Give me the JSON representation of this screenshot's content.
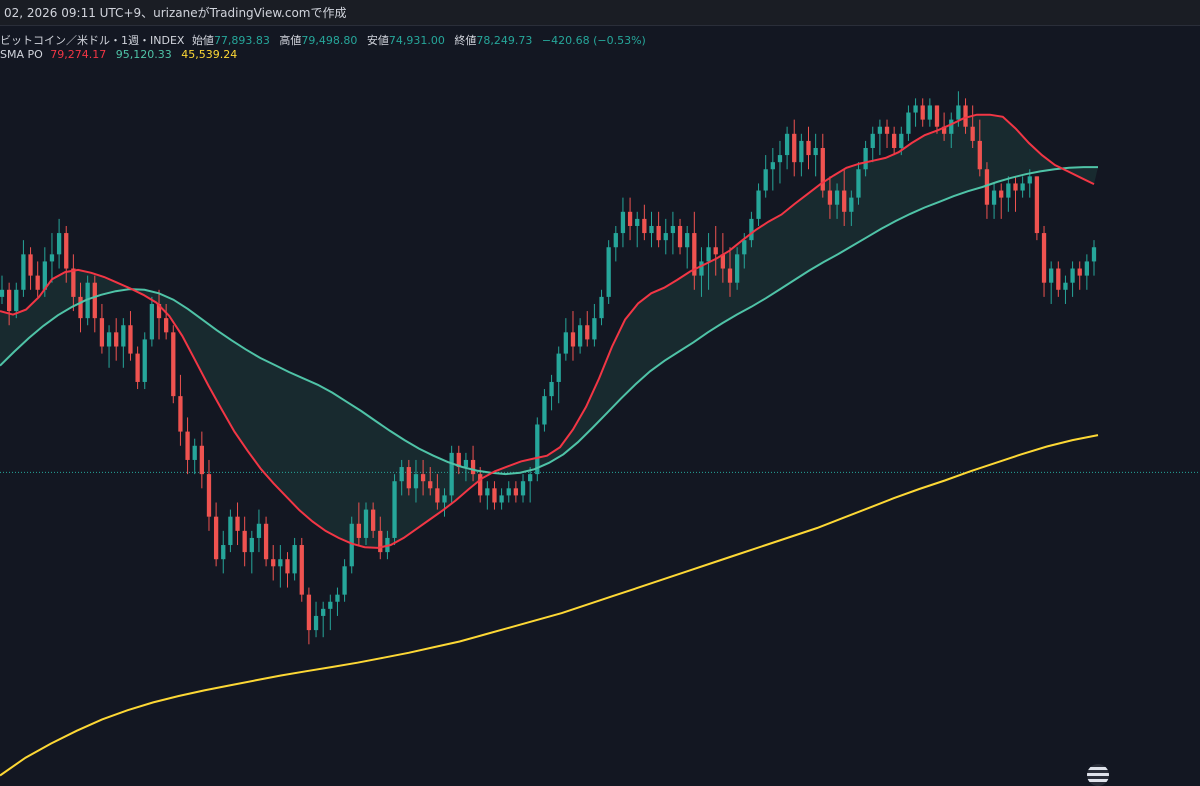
{
  "header": {
    "text": "02, 2026 09:11 UTC+9、urizaneがTradingView.comで作成"
  },
  "symbol_legend": {
    "symbol": "ビットコイン／米ドル・1週・INDEX",
    "open_label": "始値",
    "open": "77,893.83",
    "high_label": "高値",
    "high": "79,498.80",
    "low_label": "安値",
    "low": "74,931.00",
    "close_label": "終値",
    "close": "78,249.73",
    "change": "−420.68 (−0.53%)"
  },
  "indicator_legend": {
    "name": "SMA PO",
    "v1": "79,274.17",
    "v2": "95,120.33",
    "v3": "45,539.24"
  },
  "colors": {
    "background": "#131722",
    "up": "#26a69a",
    "down": "#ef5350",
    "sma_fast": "#f23645",
    "sma_mid": "#4fc3a7",
    "sma_slow": "#fdd835",
    "fill": "#1e3a3a",
    "price_line": "#26a69a"
  },
  "chart_data": {
    "type": "candlestick",
    "ylim": [
      35000,
      135000
    ],
    "current_price": 78249.73,
    "candles": [
      [
        103,
        106,
        102,
        104
      ],
      [
        104,
        105,
        99,
        101
      ],
      [
        101,
        105,
        100,
        104
      ],
      [
        104,
        111,
        103,
        109
      ],
      [
        109,
        110,
        104,
        106
      ],
      [
        106,
        108,
        103,
        104
      ],
      [
        104,
        110,
        103,
        108
      ],
      [
        108,
        112,
        105,
        109
      ],
      [
        109,
        114,
        107,
        112
      ],
      [
        112,
        113,
        105,
        107
      ],
      [
        107,
        109,
        101,
        103
      ],
      [
        103,
        105,
        98,
        100
      ],
      [
        100,
        106,
        99,
        105
      ],
      [
        105,
        106,
        98,
        100
      ],
      [
        100,
        102,
        95,
        96
      ],
      [
        96,
        99,
        93,
        98
      ],
      [
        98,
        100,
        94,
        96
      ],
      [
        96,
        100,
        93,
        99
      ],
      [
        99,
        101,
        94,
        95
      ],
      [
        95,
        96,
        90,
        91
      ],
      [
        91,
        98,
        90,
        97
      ],
      [
        97,
        103,
        96,
        102
      ],
      [
        102,
        104,
        97,
        100
      ],
      [
        100,
        102,
        97,
        98
      ],
      [
        98,
        99,
        88,
        89
      ],
      [
        89,
        92,
        82,
        84
      ],
      [
        84,
        86,
        78,
        80
      ],
      [
        80,
        83,
        78,
        82
      ],
      [
        82,
        84,
        76,
        78
      ],
      [
        78,
        80,
        70,
        72
      ],
      [
        72,
        74,
        65,
        66
      ],
      [
        66,
        70,
        64,
        68
      ],
      [
        68,
        73,
        67,
        72
      ],
      [
        72,
        74,
        68,
        70
      ],
      [
        70,
        72,
        65,
        67
      ],
      [
        67,
        70,
        64,
        69
      ],
      [
        69,
        73,
        67,
        71
      ],
      [
        71,
        72,
        65,
        66
      ],
      [
        66,
        68,
        63,
        65
      ],
      [
        65,
        68,
        62,
        66
      ],
      [
        66,
        67,
        62,
        64
      ],
      [
        64,
        69,
        63,
        68
      ],
      [
        68,
        69,
        60,
        61
      ],
      [
        61,
        62,
        54,
        56
      ],
      [
        56,
        60,
        55,
        58
      ],
      [
        58,
        60,
        55,
        59
      ],
      [
        59,
        61,
        56,
        60
      ],
      [
        60,
        62,
        58,
        61
      ],
      [
        61,
        66,
        60,
        65
      ],
      [
        65,
        72,
        64,
        71
      ],
      [
        71,
        74,
        68,
        69
      ],
      [
        69,
        74,
        68,
        73
      ],
      [
        73,
        74,
        69,
        70
      ],
      [
        70,
        72,
        66,
        67
      ],
      [
        67,
        70,
        66,
        69
      ],
      [
        69,
        78,
        68,
        77
      ],
      [
        77,
        80,
        75,
        79
      ],
      [
        79,
        80,
        75,
        76
      ],
      [
        76,
        80,
        74,
        78
      ],
      [
        78,
        80,
        75,
        77
      ],
      [
        77,
        79,
        75,
        76
      ],
      [
        76,
        78,
        73,
        74
      ],
      [
        74,
        76,
        72,
        75
      ],
      [
        75,
        82,
        74,
        81
      ],
      [
        81,
        82,
        78,
        79
      ],
      [
        79,
        81,
        77,
        80
      ],
      [
        80,
        82,
        77,
        78
      ],
      [
        78,
        79,
        74,
        75
      ],
      [
        75,
        77,
        73,
        76
      ],
      [
        76,
        77,
        73,
        74
      ],
      [
        74,
        76,
        73,
        75
      ],
      [
        75,
        77,
        74,
        76
      ],
      [
        76,
        77,
        74,
        75
      ],
      [
        75,
        78,
        74,
        77
      ],
      [
        77,
        79,
        74,
        78
      ],
      [
        78,
        86,
        77,
        85
      ],
      [
        85,
        90,
        84,
        89
      ],
      [
        89,
        92,
        87,
        91
      ],
      [
        91,
        96,
        88,
        95
      ],
      [
        95,
        100,
        94,
        98
      ],
      [
        98,
        101,
        94,
        96
      ],
      [
        96,
        100,
        95,
        99
      ],
      [
        99,
        101,
        96,
        97
      ],
      [
        97,
        102,
        96,
        100
      ],
      [
        100,
        104,
        99,
        103
      ],
      [
        103,
        111,
        102,
        110
      ],
      [
        110,
        113,
        108,
        112
      ],
      [
        112,
        117,
        110,
        115
      ],
      [
        115,
        117,
        111,
        113
      ],
      [
        113,
        115,
        110,
        114
      ],
      [
        114,
        116,
        111,
        112
      ],
      [
        112,
        115,
        110,
        113
      ],
      [
        113,
        115,
        110,
        111
      ],
      [
        111,
        114,
        109,
        112
      ],
      [
        112,
        115,
        109,
        113
      ],
      [
        113,
        114,
        109,
        110
      ],
      [
        110,
        113,
        107,
        112
      ],
      [
        112,
        115,
        104,
        106
      ],
      [
        106,
        110,
        103,
        108
      ],
      [
        108,
        112,
        104,
        110
      ],
      [
        110,
        113,
        106,
        109
      ],
      [
        109,
        112,
        105,
        107
      ],
      [
        107,
        110,
        103,
        105
      ],
      [
        105,
        110,
        104,
        109
      ],
      [
        109,
        112,
        107,
        111
      ],
      [
        111,
        115,
        110,
        114
      ],
      [
        114,
        119,
        113,
        118
      ],
      [
        118,
        123,
        117,
        121
      ],
      [
        121,
        124,
        118,
        122
      ],
      [
        122,
        125,
        119,
        123
      ],
      [
        123,
        127,
        121,
        126
      ],
      [
        126,
        128,
        120,
        122
      ],
      [
        122,
        126,
        120,
        125
      ],
      [
        125,
        127,
        121,
        123
      ],
      [
        123,
        126,
        120,
        124
      ],
      [
        124,
        126,
        117,
        118
      ],
      [
        118,
        120,
        114,
        116
      ],
      [
        116,
        119,
        114,
        118
      ],
      [
        118,
        121,
        113,
        115
      ],
      [
        115,
        118,
        113,
        117
      ],
      [
        117,
        122,
        116,
        121
      ],
      [
        121,
        125,
        120,
        124
      ],
      [
        124,
        127,
        122,
        126
      ],
      [
        126,
        128,
        123,
        127
      ],
      [
        127,
        128,
        124,
        126
      ],
      [
        126,
        127,
        123,
        124
      ],
      [
        124,
        127,
        123,
        126
      ],
      [
        126,
        130,
        125,
        129
      ],
      [
        129,
        131,
        127,
        130
      ],
      [
        130,
        131,
        127,
        128
      ],
      [
        128,
        131,
        127,
        130
      ],
      [
        130,
        130,
        126,
        127
      ],
      [
        127,
        129,
        125,
        126
      ],
      [
        126,
        129,
        124,
        128
      ],
      [
        128,
        132,
        127,
        130
      ],
      [
        130,
        131,
        126,
        127
      ],
      [
        127,
        130,
        124,
        125
      ],
      [
        125,
        128,
        120,
        121
      ],
      [
        121,
        122,
        114,
        116
      ],
      [
        116,
        119,
        114,
        118
      ],
      [
        118,
        119,
        114,
        117
      ],
      [
        117,
        120,
        115,
        119
      ],
      [
        119,
        120,
        115,
        118
      ],
      [
        118,
        120,
        117,
        119
      ],
      [
        119,
        121,
        117,
        120
      ],
      [
        120,
        120,
        111,
        112
      ],
      [
        112,
        113,
        103,
        105
      ],
      [
        105,
        108,
        102,
        107
      ],
      [
        107,
        108,
        103,
        104
      ],
      [
        104,
        106,
        102,
        105
      ],
      [
        105,
        108,
        103,
        107
      ],
      [
        107,
        108,
        104,
        106
      ],
      [
        106,
        109,
        104,
        108
      ],
      [
        108,
        111,
        106,
        110
      ]
    ],
    "sma_fast_dense": [
      101,
      100.5,
      101.2,
      103,
      105.5,
      106.5,
      106.8,
      106.4,
      105.8,
      105,
      104.2,
      103.3,
      102.2,
      100.3,
      97.5,
      94,
      90.5,
      87.2,
      84,
      81.3,
      78.8,
      76.7,
      74.8,
      72.9,
      71.3,
      70,
      69,
      68.2,
      67.7,
      67.6,
      68,
      69,
      70.3,
      71.6,
      72.9,
      74.3,
      75.9,
      77.4,
      78.4,
      79.1,
      79.8,
      80.2,
      80.6,
      81.8,
      84.3,
      87.5,
      91.5,
      96,
      99.8,
      102.1,
      103.5,
      104.3,
      105.4,
      106.6,
      107.5,
      108.4,
      109.5,
      111,
      112.4,
      113.6,
      114.6,
      116.1,
      117.5,
      118.9,
      120.1,
      121.2,
      121.8,
      122.2,
      122.6,
      123.4,
      124.7,
      125.8,
      126.5,
      127.3,
      128.2,
      128.7,
      128.7,
      128.4,
      126.7,
      124.7,
      123,
      121.6,
      120.7,
      119.8,
      118.9
    ],
    "sma_mid_dense": [
      93.3,
      95.3,
      97.2,
      98.9,
      100.4,
      101.6,
      102.6,
      103.3,
      103.8,
      104.1,
      104,
      103.5,
      102.6,
      101.3,
      99.8,
      98.3,
      96.9,
      95.6,
      94.4,
      93.4,
      92.4,
      91.5,
      90.6,
      89.5,
      88.2,
      86.9,
      85.5,
      84.1,
      82.8,
      81.6,
      80.6,
      79.7,
      79,
      78.5,
      78.2,
      78,
      78.2,
      78.7,
      79.6,
      80.8,
      82.5,
      84.5,
      86.6,
      88.7,
      90.7,
      92.5,
      94,
      95.3,
      96.6,
      98,
      99.3,
      100.5,
      101.6,
      102.8,
      104.1,
      105.4,
      106.7,
      107.9,
      109,
      110.2,
      111.4,
      112.6,
      113.7,
      114.7,
      115.6,
      116.4,
      117.2,
      117.9,
      118.5,
      119.2,
      119.8,
      120.3,
      120.7,
      121,
      121.2,
      121.3,
      121.3
    ],
    "sma_slow_dense": [
      35.5,
      38,
      40,
      41.8,
      43.4,
      44.7,
      45.8,
      46.7,
      47.5,
      48.2,
      48.9,
      49.6,
      50.2,
      50.8,
      51.4,
      52.1,
      52.8,
      53.6,
      54.4,
      55.4,
      56.4,
      57.4,
      58.4,
      59.6,
      60.8,
      62,
      63.2,
      64.4,
      65.6,
      66.8,
      68,
      69.2,
      70.4,
      71.8,
      73.2,
      74.6,
      75.9,
      77.1,
      78.4,
      79.6,
      80.8,
      81.9,
      82.8,
      83.5
    ]
  }
}
